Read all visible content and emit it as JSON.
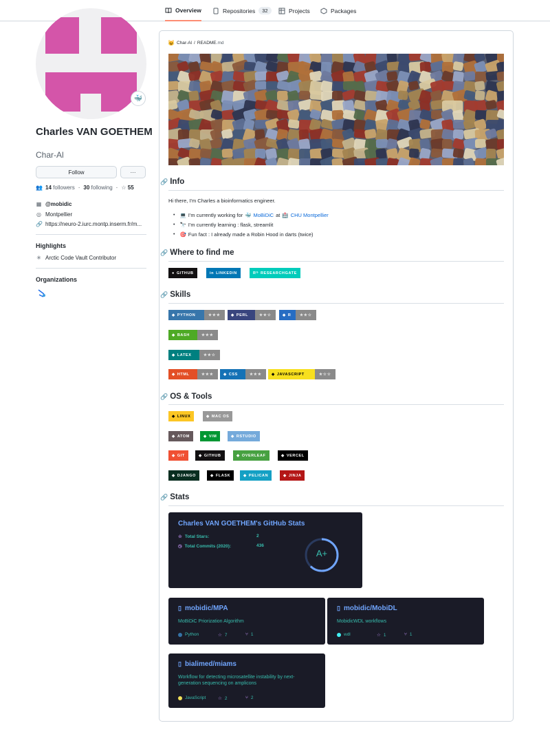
{
  "tabs": [
    {
      "label": "Overview",
      "icon": "book-icon",
      "selected": true
    },
    {
      "label": "Repositories",
      "icon": "repo-icon",
      "count": "32"
    },
    {
      "label": "Projects",
      "icon": "project-icon"
    },
    {
      "label": "Packages",
      "icon": "package-icon"
    }
  ],
  "profile": {
    "name": "Charles VAN GOETHEM",
    "login": "Char-Al",
    "follow_label": "Follow",
    "more_label": "···",
    "followers_count": "14",
    "followers_label": "followers",
    "following_count": "30",
    "following_label": "following",
    "stars_count": "55",
    "org": "@mobidic",
    "location": "Montpellier",
    "website": "https://neuro-2.iurc.montp.inserm.fr/m...",
    "avatar_color": "#d455a9"
  },
  "highlights": {
    "heading": "Highlights",
    "item": "Arctic Code Vault Contributor"
  },
  "organizations": {
    "heading": "Organizations"
  },
  "readme": {
    "crumb_user": "Char-Al",
    "crumb_sep": "/",
    "crumb_file": "README",
    "crumb_ext": ".md",
    "info_heading": "Info",
    "intro": "Hi there, I'm Charles a bioinformatics engineer.",
    "bullets": [
      {
        "emoji": "💻",
        "pre": "I'm currently working for",
        "link1": "MoBiDiC",
        "mid": "at",
        "link2": "CHU Montpellier"
      },
      {
        "emoji": "🔭",
        "pre": "I'm currently learning : flask, streamlit"
      },
      {
        "emoji": "🎯",
        "pre": "Fun fact : I already made a Robin Hood in darts (twice)"
      }
    ],
    "where_heading": "Where to find me",
    "where_badges": [
      "GITHUB",
      "LINKEDIN",
      "RESEARCHGATE"
    ],
    "skills_heading": "Skills",
    "skills": [
      {
        "label": "PYTHON",
        "rating": "★★★",
        "color": "#3776ab"
      },
      {
        "label": "PERL",
        "rating": "★★☆",
        "color": "#39457e"
      },
      {
        "label": "R",
        "rating": "★★☆",
        "color": "#276dc3"
      },
      {
        "label": "BASH",
        "rating": "★★★",
        "color": "#4eaa25"
      },
      {
        "label": "LATEX",
        "rating": "★★☆",
        "color": "#008080"
      },
      {
        "label": "HTML",
        "rating": "★★★",
        "color": "#e34f26"
      },
      {
        "label": "CSS",
        "rating": "★★★",
        "color": "#1572b6"
      },
      {
        "label": "JAVASCRIPT",
        "rating": "★☆☆",
        "color": "#f7df1e"
      }
    ],
    "tools_heading": "OS & Tools",
    "tools": [
      {
        "label": "LINUX",
        "color": "#fcc624",
        "text": "#000"
      },
      {
        "label": "MAC OS",
        "color": "#999999",
        "text": "#fff"
      },
      {
        "label": "ATOM",
        "color": "#66595c",
        "text": "#fff"
      },
      {
        "label": "VIM",
        "color": "#019733",
        "text": "#fff"
      },
      {
        "label": "RSTUDIO",
        "color": "#75aadb",
        "text": "#fff"
      },
      {
        "label": "GIT",
        "color": "#f05033",
        "text": "#fff"
      },
      {
        "label": "GITHUB",
        "color": "#121011",
        "text": "#fff"
      },
      {
        "label": "OVERLEAF",
        "color": "#47a141",
        "text": "#fff"
      },
      {
        "label": "VERCEL",
        "color": "#000000",
        "text": "#fff"
      },
      {
        "label": "DJANGO",
        "color": "#092e20",
        "text": "#fff"
      },
      {
        "label": "FLASK",
        "color": "#000000",
        "text": "#fff"
      },
      {
        "label": "PELICAN",
        "color": "#14a0c4",
        "text": "#fff"
      },
      {
        "label": "JINJA",
        "color": "#b41717",
        "text": "#fff"
      }
    ],
    "stats_heading": "Stats",
    "stats_card": {
      "title": "Charles VAN GOETHEM's GitHub Stats",
      "stars_label": "Total Stars:",
      "stars_value": "2",
      "commits_label": "Total Commits (2020):",
      "commits_value": "436",
      "grade": "A+"
    },
    "repos": [
      {
        "name": "mobidic/MPA",
        "desc": "MoBiDiC Priorization Algorithm",
        "lang": "Python",
        "lang_color": "#3572a5",
        "stars": "7",
        "forks": "1"
      },
      {
        "name": "mobidic/MobiDL",
        "desc": "MobidicWDL workflows",
        "lang": "wdl",
        "lang_color": "#42f1f4",
        "stars": "1",
        "forks": "1"
      },
      {
        "name": "bialimed/miams",
        "desc": "Workflow for detecting microsatellite instability by next-generation sequencing on amplicons",
        "lang": "JavaScript",
        "lang_color": "#f1e05a",
        "stars": "2",
        "forks": "2"
      }
    ]
  },
  "colors": {
    "accent": "#fd8c73",
    "link": "#0969da",
    "card_bg": "#1a1b27",
    "card_title": "#70a5fd",
    "card_text": "#38bdae"
  }
}
